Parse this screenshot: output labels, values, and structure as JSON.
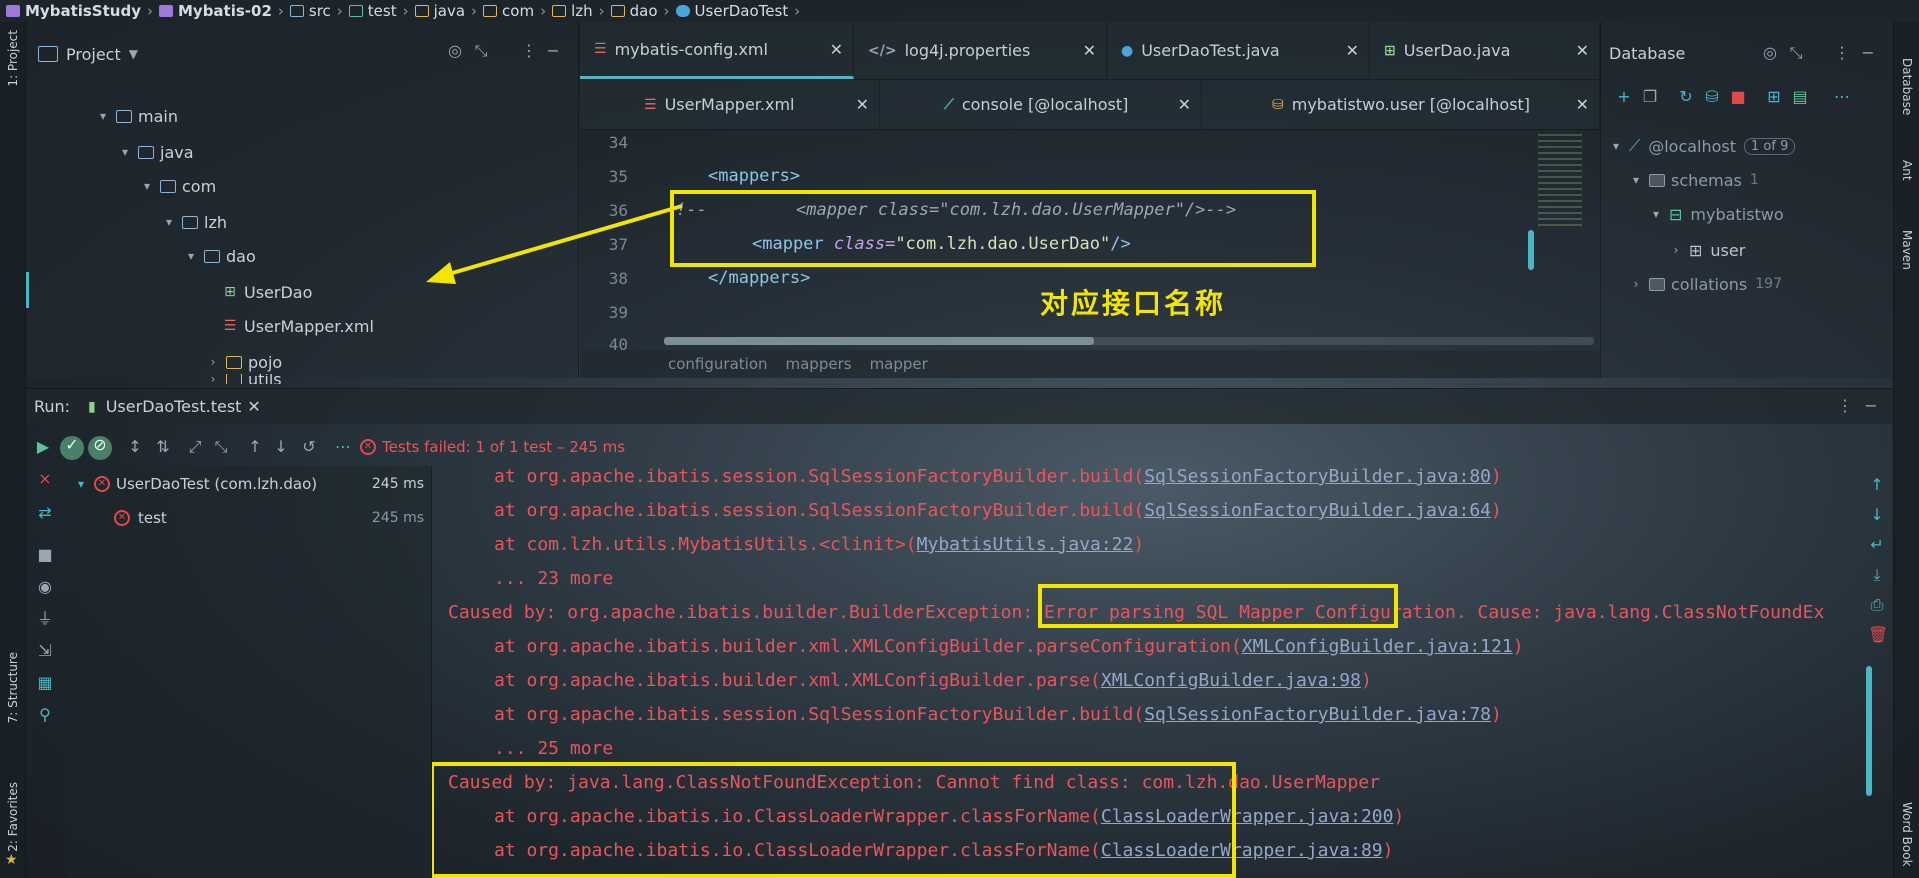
{
  "breadcrumb": [
    "MybatisStudy",
    "Mybatis-02",
    "src",
    "test",
    "java",
    "com",
    "lzh",
    "dao",
    "UserDaoTest"
  ],
  "left_strip": {
    "project": "1: Project",
    "structure": "7: Structure",
    "favorites": "2: Favorites"
  },
  "right_strip": {
    "database": "Database",
    "ant": "Ant",
    "maven": "Maven",
    "word_book": "Word Book"
  },
  "project_panel": {
    "title": "Project",
    "tree": [
      {
        "label": "main",
        "type": "folder"
      },
      {
        "label": "java",
        "type": "folder"
      },
      {
        "label": "com",
        "type": "folder"
      },
      {
        "label": "lzh",
        "type": "folder"
      },
      {
        "label": "dao",
        "type": "folder"
      },
      {
        "label": "UserDao",
        "type": "interface"
      },
      {
        "label": "UserMapper.xml",
        "type": "xml"
      },
      {
        "label": "pojo",
        "type": "folder"
      },
      {
        "label": "utils",
        "type": "folder"
      }
    ]
  },
  "editor": {
    "tabs_row1": [
      {
        "label": "mybatis-config.xml",
        "active": true
      },
      {
        "label": "log4j.properties",
        "active": false
      },
      {
        "label": "UserDaoTest.java",
        "active": false
      },
      {
        "label": "UserDao.java",
        "active": false
      }
    ],
    "tabs_row2": [
      {
        "label": "UserMapper.xml"
      },
      {
        "label": "console [@localhost]"
      },
      {
        "label": "mybatistwo.user [@localhost]"
      }
    ],
    "line_numbers": [
      "34",
      "35",
      "36",
      "37",
      "38",
      "39",
      "40"
    ],
    "lines": {
      "l35_open": "<mappers>",
      "l36_prefix": "!--",
      "l36_comment": "<mapper class=\"com.lzh.dao.UserMapper\"/>-->",
      "l37_tag_open": "<mapper ",
      "l37_attr": "class=",
      "l37_value": "\"com.lzh.dao.UserDao\"",
      "l37_tag_close": "/>",
      "l38_close": "</mappers>"
    },
    "annotation": "对应接口名称",
    "code_breadcrumb": [
      "configuration",
      "mappers",
      "mapper"
    ]
  },
  "database_panel": {
    "title": "Database",
    "host": "@localhost",
    "host_count": "1 of 9",
    "schemas": "schemas",
    "schemas_count": "1",
    "schema_name": "mybatistwo",
    "table": "user",
    "collations": "collations",
    "collations_count": "197"
  },
  "run": {
    "label": "Run:",
    "tab": "UserDaoTest.test",
    "status": "Tests failed: 1 of 1 test – 245 ms",
    "tree": [
      {
        "label": "UserDaoTest (com.lzh.dao)",
        "time": "245 ms"
      },
      {
        "label": "test",
        "time": "245 ms"
      }
    ]
  },
  "console": [
    {
      "indent": true,
      "text": "at org.apache.ibatis.session.SqlSessionFactoryBuilder.build(",
      "link": "SqlSessionFactoryBuilder.java:80",
      "tail": ")"
    },
    {
      "indent": true,
      "text": "at org.apache.ibatis.session.SqlSessionFactoryBuilder.build(",
      "link": "SqlSessionFactoryBuilder.java:64",
      "tail": ")"
    },
    {
      "indent": true,
      "text": "at com.lzh.utils.MybatisUtils.<clinit>(",
      "link": "MybatisUtils.java:22",
      "tail": ")"
    },
    {
      "indent": true,
      "text": "... 23 more",
      "link": "",
      "tail": ""
    },
    {
      "indent": false,
      "text": "Caused by: org.apache.ibatis.builder.BuilderException: Error parsing SQL Mapper Configuration. Cause: java.lang.ClassNotFoundEx",
      "link": "",
      "tail": ""
    },
    {
      "indent": true,
      "text": "at org.apache.ibatis.builder.xml.XMLConfigBuilder.parseConfiguration(",
      "link": "XMLConfigBuilder.java:121",
      "tail": ")"
    },
    {
      "indent": true,
      "text": "at org.apache.ibatis.builder.xml.XMLConfigBuilder.parse(",
      "link": "XMLConfigBuilder.java:98",
      "tail": ")"
    },
    {
      "indent": true,
      "text": "at org.apache.ibatis.session.SqlSessionFactoryBuilder.build(",
      "link": "SqlSessionFactoryBuilder.java:78",
      "tail": ")"
    },
    {
      "indent": true,
      "text": "... 25 more",
      "link": "",
      "tail": ""
    },
    {
      "indent": false,
      "text": "Caused by: java.lang.ClassNotFoundException: Cannot find class: com.lzh.dao.UserMapper",
      "link": "",
      "tail": ""
    },
    {
      "indent": true,
      "text": "at org.apache.ibatis.io.ClassLoaderWrapper.classForName(",
      "link": "ClassLoaderWrapper.java:200",
      "tail": ")"
    },
    {
      "indent": true,
      "text": "at org.apache.ibatis.io.ClassLoaderWrapper.classForName(",
      "link": "ClassLoaderWrapper.java:89",
      "tail": ")"
    }
  ],
  "colors": {
    "highlight": "#f2e600",
    "error": "#e8565b",
    "accent": "#4ab7c4",
    "link": "#93a7c9"
  }
}
